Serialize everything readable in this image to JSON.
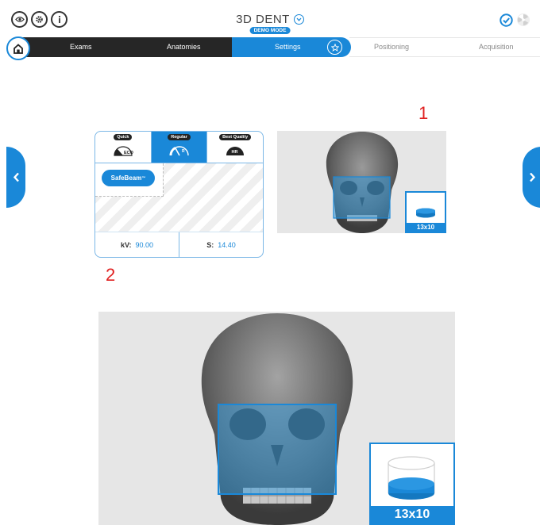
{
  "header": {
    "title": "3D DENT",
    "badge": "DEMO MODE",
    "left_icons": [
      "eye-icon",
      "settings-icon",
      "info-icon"
    ],
    "right_icons": [
      "check-circle-icon",
      "radiation-icon"
    ]
  },
  "nav": {
    "home_icon": "home-icon",
    "items": [
      {
        "label": "Exams"
      },
      {
        "label": "Anatomies"
      },
      {
        "label": "Settings"
      },
      {
        "label": "Positioning"
      },
      {
        "label": "Acquisition"
      }
    ],
    "favorite_icon": "star-icon"
  },
  "annotations": {
    "one": "1",
    "two": "2"
  },
  "mode_card": {
    "tabs": [
      {
        "label": "Quick",
        "icon": "eco-gauge-icon"
      },
      {
        "label": "Regular",
        "icon": "regular-gauge-icon"
      },
      {
        "label": "Best Quality",
        "icon": "hr-gauge-icon"
      }
    ],
    "safebeam": {
      "label": "SafeBeam",
      "mark": "™"
    },
    "kv": {
      "label": "kV:",
      "value": "90.00"
    },
    "s": {
      "label": "S:",
      "value": "14.40"
    }
  },
  "fov": {
    "small_label": "13x10",
    "large_label": "13x10"
  },
  "colors": {
    "accent": "#1a88d8",
    "dark": "#262626",
    "annotation": "#e02020"
  }
}
